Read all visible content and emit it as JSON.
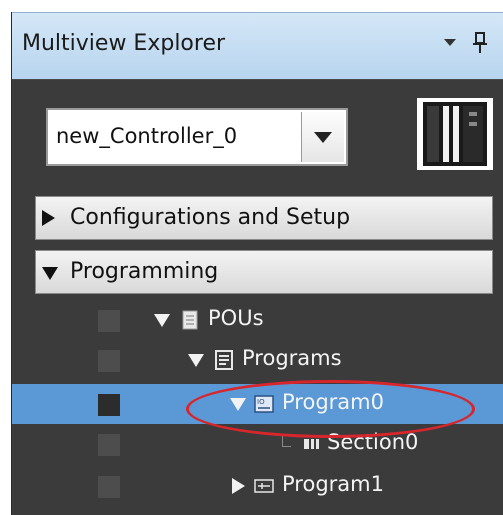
{
  "window": {
    "title": "Multiview Explorer",
    "dropdown_icon": "chevron-down-icon",
    "pin_icon": "pin-icon"
  },
  "controller": {
    "selected": "new_Controller_0",
    "device_icon": "controller-device-icon"
  },
  "sections": [
    {
      "label": "Configurations and Setup",
      "expanded": false
    },
    {
      "label": "Programming",
      "expanded": true
    }
  ],
  "tree": [
    {
      "label": "POUs",
      "icon": "document-icon",
      "expanded": true,
      "selected": false
    },
    {
      "label": "Programs",
      "icon": "list-document-icon",
      "expanded": true,
      "selected": false
    },
    {
      "label": "Program0",
      "icon": "program-icon",
      "expanded": true,
      "selected": true
    },
    {
      "label": "Section0",
      "icon": "section-icon",
      "leaf": true,
      "selected": false
    },
    {
      "label": "Program1",
      "icon": "program-icon",
      "expanded": false,
      "selected": false
    }
  ],
  "colors": {
    "panel_bg": "#3b3b3b",
    "selection": "#5a98d6",
    "highlight": "#d7262c",
    "titlebar": "#c6ddf2"
  }
}
